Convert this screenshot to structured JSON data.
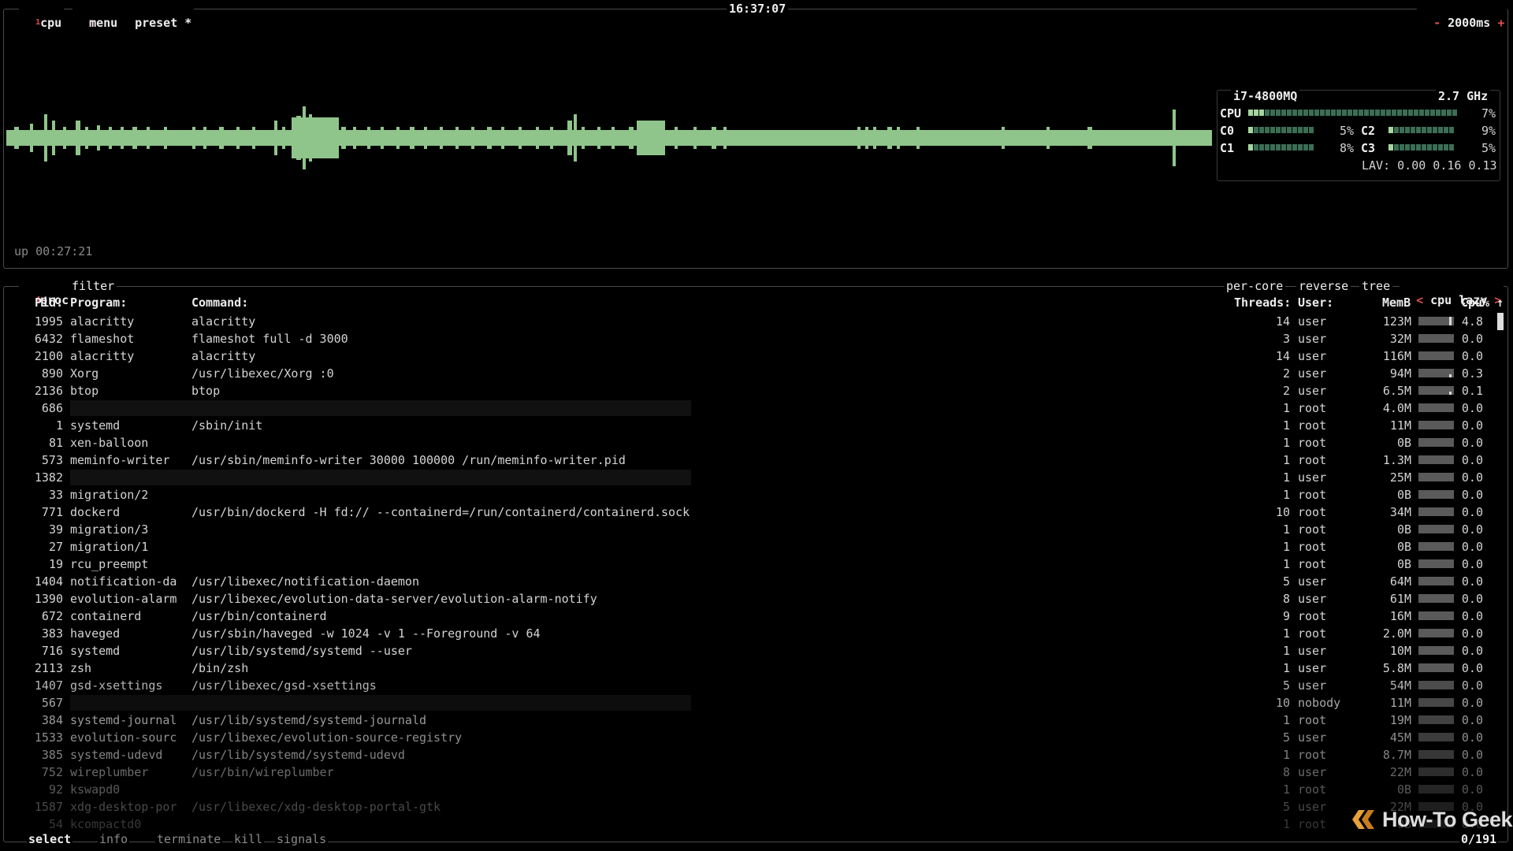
{
  "cpu_box": {
    "tab_number": "1",
    "tab_label": "cpu",
    "menu_label": "menu",
    "preset_label": "preset *",
    "clock": "16:37:07",
    "interval_minus": "-",
    "interval": "2000ms",
    "interval_plus": "+",
    "uptime": "up 00:27:21",
    "graph_color": "#8fc58a"
  },
  "cpu_info": {
    "model": "i7-4800MQ",
    "freq": "2.7 GHz",
    "total_label": "CPU",
    "total_pct": "7%",
    "total_level": 0.07,
    "cores": [
      {
        "name": "C0",
        "pct": "5%",
        "level": 0.05
      },
      {
        "name": "C1",
        "pct": "8%",
        "level": 0.08
      },
      {
        "name": "C2",
        "pct": "9%",
        "level": 0.09
      },
      {
        "name": "C3",
        "pct": "5%",
        "level": 0.05
      }
    ],
    "lav": "LAV: 0.00 0.16 0.13"
  },
  "proc_box": {
    "tab_number": "4",
    "tab_label": "proc",
    "filter_label": "filter",
    "per_core": "per-core",
    "reverse": "reverse",
    "tree": "tree",
    "sort_left": "<",
    "sort_label": "cpu lazy",
    "sort_right": ">",
    "columns": {
      "pid": "Pid:",
      "program": "Program:",
      "command": "Command:",
      "threads": "Threads:",
      "user": "User:",
      "mem": "MemB",
      "cpu": "Cpu%",
      "sort_arrow": "↑"
    },
    "rows": [
      {
        "pid": "1995",
        "program": "alacritty",
        "command": "alacritty",
        "threads": "14",
        "user": "user",
        "mem": "123M",
        "cpu": "4.8"
      },
      {
        "pid": "6432",
        "program": "flameshot",
        "command": "flameshot full -d 3000",
        "threads": "3",
        "user": "user",
        "mem": "32M",
        "cpu": "0.0"
      },
      {
        "pid": "2100",
        "program": "alacritty",
        "command": "alacritty",
        "threads": "14",
        "user": "user",
        "mem": "116M",
        "cpu": "0.0"
      },
      {
        "pid": "890",
        "program": "Xorg",
        "command": "/usr/libexec/Xorg :0",
        "threads": "2",
        "user": "user",
        "mem": "94M",
        "cpu": "0.3"
      },
      {
        "pid": "2136",
        "program": "btop",
        "command": "btop",
        "threads": "2",
        "user": "user",
        "mem": "6.5M",
        "cpu": "0.1"
      },
      {
        "pid": "686",
        "program": "",
        "command": "",
        "threads": "1",
        "user": "root",
        "mem": "4.0M",
        "cpu": "0.0"
      },
      {
        "pid": "1",
        "program": "systemd",
        "command": "/sbin/init",
        "threads": "1",
        "user": "root",
        "mem": "11M",
        "cpu": "0.0"
      },
      {
        "pid": "81",
        "program": "xen-balloon",
        "command": "",
        "threads": "1",
        "user": "root",
        "mem": "0B",
        "cpu": "0.0"
      },
      {
        "pid": "573",
        "program": "meminfo-writer",
        "command": "/usr/sbin/meminfo-writer 30000 100000 /run/meminfo-writer.pid",
        "threads": "1",
        "user": "root",
        "mem": "1.3M",
        "cpu": "0.0"
      },
      {
        "pid": "1382",
        "program": "",
        "command": "",
        "threads": "1",
        "user": "user",
        "mem": "25M",
        "cpu": "0.0"
      },
      {
        "pid": "33",
        "program": "migration/2",
        "command": "",
        "threads": "1",
        "user": "root",
        "mem": "0B",
        "cpu": "0.0"
      },
      {
        "pid": "771",
        "program": "dockerd",
        "command": "/usr/bin/dockerd -H fd:// --containerd=/run/containerd/containerd.sock",
        "threads": "10",
        "user": "root",
        "mem": "34M",
        "cpu": "0.0"
      },
      {
        "pid": "39",
        "program": "migration/3",
        "command": "",
        "threads": "1",
        "user": "root",
        "mem": "0B",
        "cpu": "0.0"
      },
      {
        "pid": "27",
        "program": "migration/1",
        "command": "",
        "threads": "1",
        "user": "root",
        "mem": "0B",
        "cpu": "0.0"
      },
      {
        "pid": "19",
        "program": "rcu_preempt",
        "command": "",
        "threads": "1",
        "user": "root",
        "mem": "0B",
        "cpu": "0.0"
      },
      {
        "pid": "1404",
        "program": "notification-da",
        "command": "/usr/libexec/notification-daemon",
        "threads": "5",
        "user": "user",
        "mem": "64M",
        "cpu": "0.0"
      },
      {
        "pid": "1390",
        "program": "evolution-alarm",
        "command": "/usr/libexec/evolution-data-server/evolution-alarm-notify",
        "threads": "8",
        "user": "user",
        "mem": "61M",
        "cpu": "0.0"
      },
      {
        "pid": "672",
        "program": "containerd",
        "command": "/usr/bin/containerd",
        "threads": "9",
        "user": "root",
        "mem": "16M",
        "cpu": "0.0"
      },
      {
        "pid": "383",
        "program": "haveged",
        "command": "/usr/sbin/haveged -w 1024 -v 1 --Foreground -v 64",
        "threads": "1",
        "user": "root",
        "mem": "2.0M",
        "cpu": "0.0"
      },
      {
        "pid": "716",
        "program": "systemd",
        "command": "/usr/lib/systemd/systemd --user",
        "threads": "1",
        "user": "user",
        "mem": "10M",
        "cpu": "0.0"
      },
      {
        "pid": "2113",
        "program": "zsh",
        "command": "/bin/zsh",
        "threads": "1",
        "user": "user",
        "mem": "5.8M",
        "cpu": "0.0"
      },
      {
        "pid": "1407",
        "program": "gsd-xsettings",
        "command": "/usr/libexec/gsd-xsettings",
        "threads": "5",
        "user": "user",
        "mem": "54M",
        "cpu": "0.0"
      },
      {
        "pid": "567",
        "program": "",
        "command": "",
        "threads": "10",
        "user": "nobody",
        "mem": "11M",
        "cpu": "0.0"
      },
      {
        "pid": "384",
        "program": "systemd-journal",
        "command": "/usr/lib/systemd/systemd-journald",
        "threads": "1",
        "user": "root",
        "mem": "19M",
        "cpu": "0.0"
      },
      {
        "pid": "1533",
        "program": "evolution-sourc",
        "command": "/usr/libexec/evolution-source-registry",
        "threads": "5",
        "user": "user",
        "mem": "45M",
        "cpu": "0.0"
      },
      {
        "pid": "385",
        "program": "systemd-udevd",
        "command": "/usr/lib/systemd/systemd-udevd",
        "threads": "1",
        "user": "root",
        "mem": "8.7M",
        "cpu": "0.0"
      },
      {
        "pid": "752",
        "program": "wireplumber",
        "command": "/usr/bin/wireplumber",
        "threads": "8",
        "user": "user",
        "mem": "22M",
        "cpu": "0.0"
      },
      {
        "pid": "92",
        "program": "kswapd0",
        "command": "",
        "threads": "1",
        "user": "root",
        "mem": "0B",
        "cpu": "0.0"
      },
      {
        "pid": "1587",
        "program": "xdg-desktop-por",
        "command": "/usr/libexec/xdg-desktop-portal-gtk",
        "threads": "5",
        "user": "user",
        "mem": "22M",
        "cpu": "0.0"
      },
      {
        "pid": "54",
        "program": "kcompactd0",
        "command": "",
        "threads": "1",
        "user": "root",
        "mem": "0B",
        "cpu": "0.0"
      }
    ],
    "footer": {
      "select": "select",
      "info": "info",
      "terminate": "terminate",
      "kill": "kill",
      "signals": "signals",
      "count": "0/191"
    }
  },
  "watermark": {
    "text": "How-To Geek",
    "color": "#e8a03a",
    "icon": "htg-logo-icon"
  }
}
